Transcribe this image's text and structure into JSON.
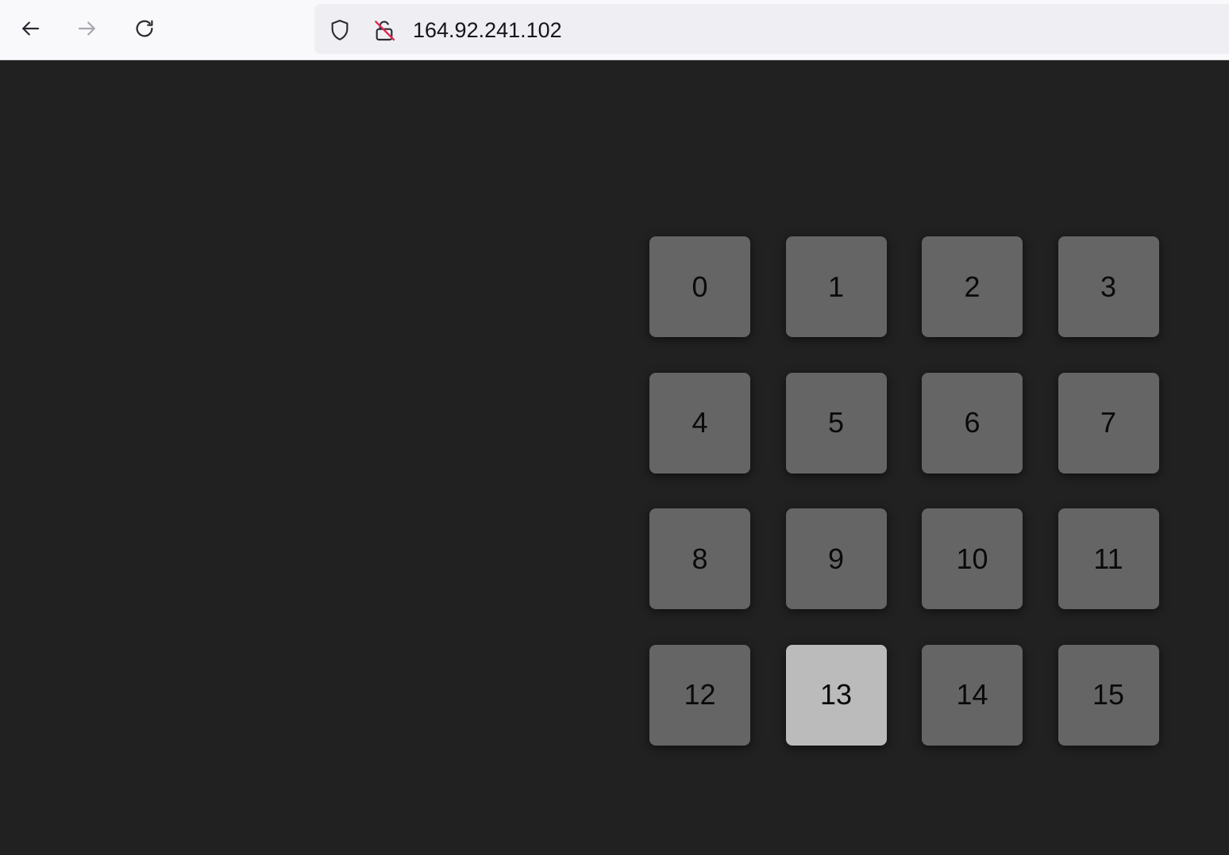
{
  "browser": {
    "url": "164.92.241.102",
    "icons": {
      "back": "arrow-left-icon",
      "forward": "arrow-right-icon",
      "reload": "reload-icon",
      "shield": "shield-icon",
      "lock": "insecure-lock-icon"
    }
  },
  "grid": {
    "tiles": [
      "0",
      "1",
      "2",
      "3",
      "4",
      "5",
      "6",
      "7",
      "8",
      "9",
      "10",
      "11",
      "12",
      "13",
      "14",
      "15"
    ],
    "highlighted": "13"
  },
  "colors": {
    "page_bg": "#212121",
    "tile": "#656565",
    "tile_highlight": "#bbbbbb",
    "insecure_slash": "#e22850"
  }
}
